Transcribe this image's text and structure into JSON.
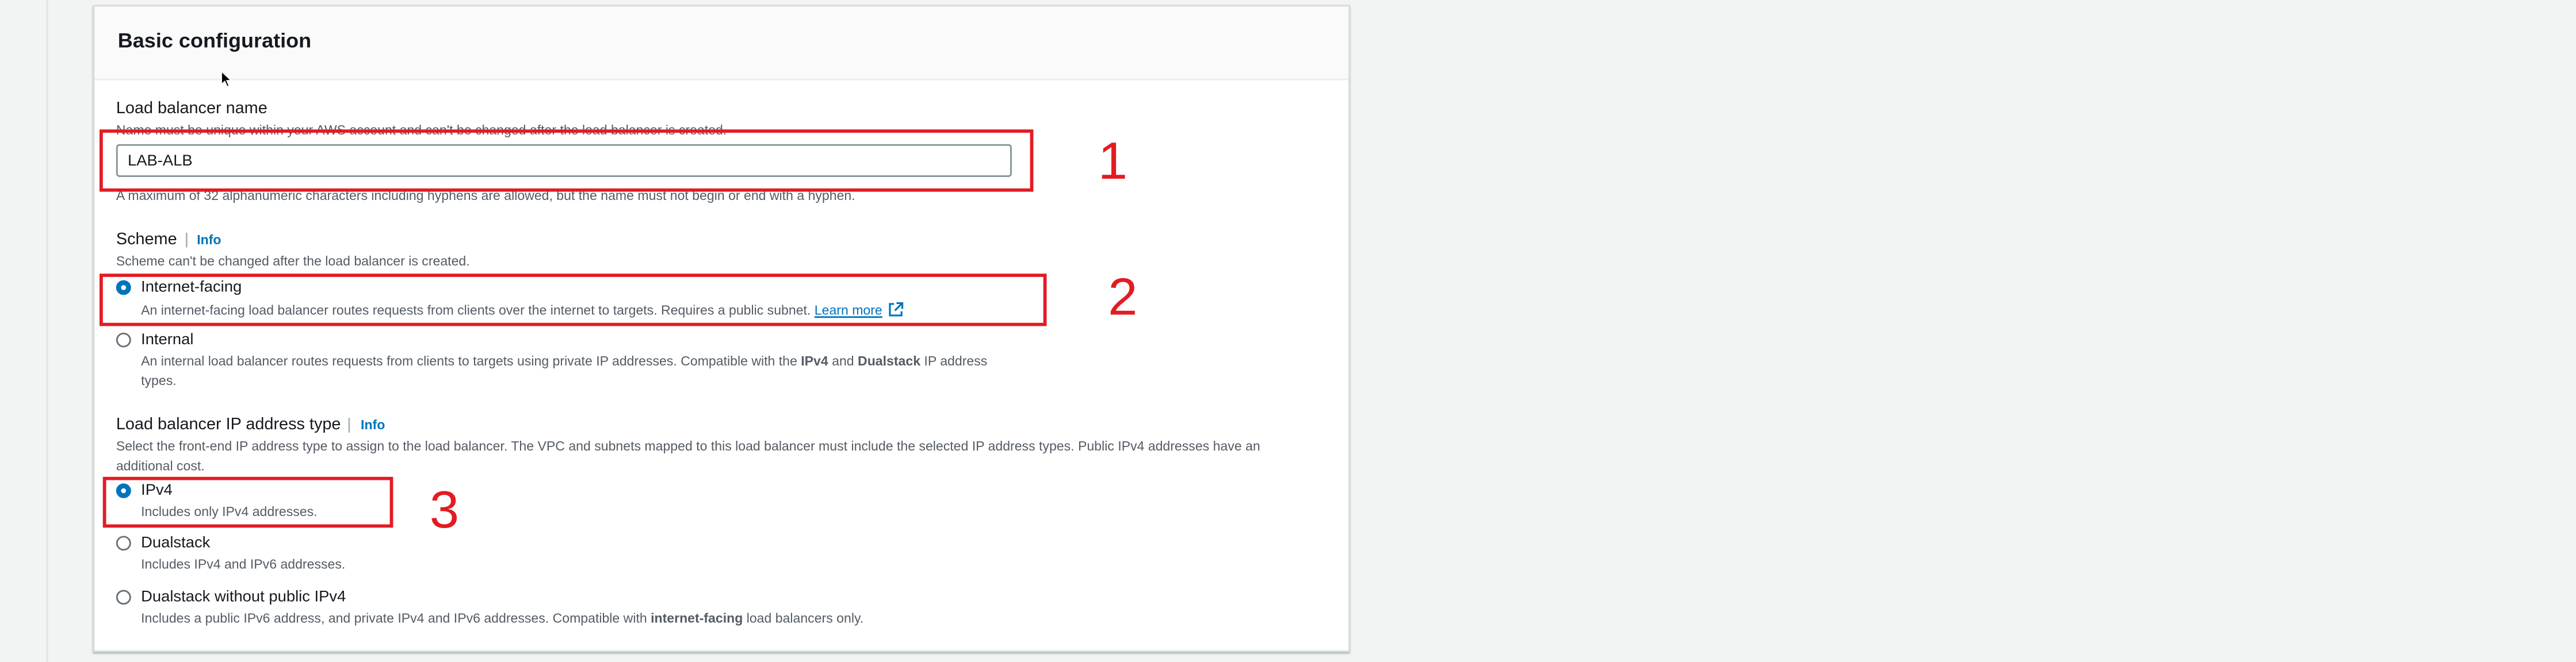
{
  "card": {
    "title": "Basic configuration"
  },
  "lb_name": {
    "label": "Load balancer name",
    "hint_top": "Name must be unique within your AWS account and can't be changed after the load balancer is created.",
    "value": "LAB-ALB",
    "hint_bottom": "A maximum of 32 alphanumeric characters including hyphens are allowed, but the name must not begin or end with a hyphen."
  },
  "scheme": {
    "label": "Scheme",
    "info": "Info",
    "description": "Scheme can't be changed after the load balancer is created.",
    "options": [
      {
        "label": "Internet-facing",
        "description": "An internet-facing load balancer routes requests from clients over the internet to targets. Requires a public subnet.",
        "link": "Learn more",
        "selected": true
      },
      {
        "label": "Internal",
        "description_pre": "An internal load balancer routes requests from clients to targets using private IP addresses. Compatible with the ",
        "bold1": "IPv4",
        "mid": " and ",
        "bold2": "Dualstack",
        "description_post": " IP address types.",
        "selected": false
      }
    ]
  },
  "ip_type": {
    "label": "Load balancer IP address type",
    "info": "Info",
    "description": "Select the front-end IP address type to assign to the load balancer. The VPC and subnets mapped to this load balancer must include the selected IP address types. Public IPv4 addresses have an additional cost.",
    "options": [
      {
        "label": "IPv4",
        "description": "Includes only IPv4 addresses.",
        "selected": true
      },
      {
        "label": "Dualstack",
        "description": "Includes IPv4 and IPv6 addresses.",
        "selected": false
      },
      {
        "label": "Dualstack without public IPv4",
        "description_pre": "Includes a public IPv6 address, and private IPv4 and IPv6 addresses. Compatible with ",
        "bold": "internet-facing",
        "description_post": " load balancers only.",
        "selected": false
      }
    ]
  },
  "annotations": [
    "1",
    "2",
    "3"
  ],
  "colors": {
    "annotation": "#e31b23",
    "link": "#0073bb",
    "radio_selected": "#0073bb"
  }
}
